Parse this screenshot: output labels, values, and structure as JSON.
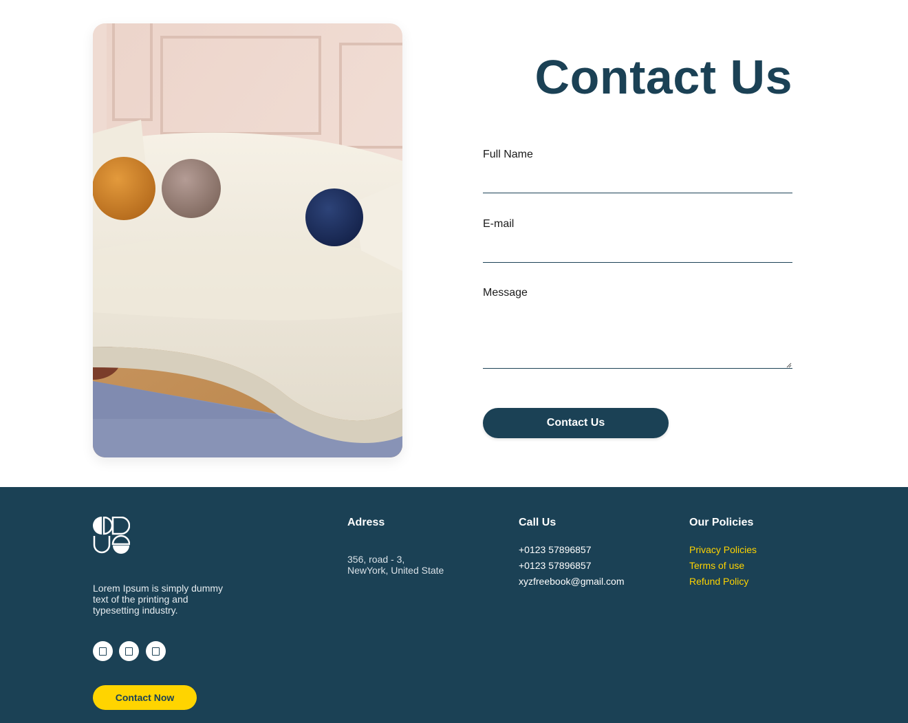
{
  "contact": {
    "title": "Contact Us",
    "fields": {
      "full_name_label": "Full Name",
      "email_label": "E-mail",
      "message_label": "Message"
    },
    "submit_label": "Contact Us"
  },
  "footer": {
    "description": "Lorem Ipsum is simply dummy text of the printing and typesetting industry.",
    "contact_now_label": "Contact Now",
    "address": {
      "heading": "Adress",
      "line1": "356, road - 3,",
      "line2": "NewYork, United State"
    },
    "call": {
      "heading": "Call Us",
      "phone1": "+0123 57896857",
      "phone2": "+0123 57896857",
      "email": "xyzfreebook@gmail.com"
    },
    "policies": {
      "heading": "Our Policies",
      "items": [
        "Privacy Policies",
        "Terms of use",
        "Refund Policy"
      ]
    },
    "social_icons": [
      "social-icon-1",
      "social-icon-2",
      "social-icon-3"
    ]
  },
  "colors": {
    "primary": "#1b4155",
    "accent": "#ffd400",
    "background": "#ffffff"
  }
}
